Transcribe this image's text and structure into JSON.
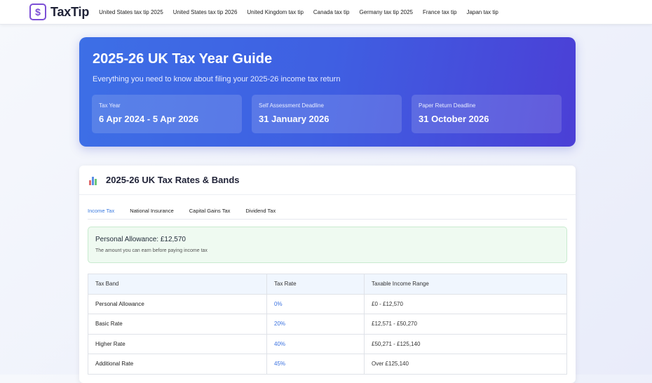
{
  "header": {
    "logo_symbol": "$",
    "logo_text": "TaxTip",
    "nav": [
      "United States tax tip 2025",
      "United States tax tip 2026",
      "United Kingdom tax tip",
      "Canada tax tip",
      "Germany tax tip 2025",
      "France tax tip",
      "Japan tax tip"
    ]
  },
  "hero": {
    "title": "2025-26 UK Tax Year Guide",
    "subtitle": "Everything you need to know about filing your 2025-26 income tax return",
    "cards": [
      {
        "label": "Tax Year",
        "value": "6 Apr 2024 - 5 Apr 2026"
      },
      {
        "label": "Self Assessment Deadline",
        "value": "31 January 2026"
      },
      {
        "label": "Paper Return Deadline",
        "value": "31 October 2026"
      }
    ]
  },
  "rates": {
    "title": "2025-26 UK Tax Rates & Bands",
    "tabs": [
      "Income Tax",
      "National Insurance",
      "Capital Gains Tax",
      "Dividend Tax"
    ],
    "active_tab": "Income Tax",
    "allowance": {
      "title": "Personal Allowance: £12,570",
      "description": "The amount you can earn before paying income tax"
    },
    "table": {
      "headers": [
        "Tax Band",
        "Tax Rate",
        "Taxable Income Range"
      ],
      "rows": [
        [
          "Personal Allowance",
          "0%",
          "£0 - £12,570"
        ],
        [
          "Basic Rate",
          "20%",
          "£12,571 - £50,270"
        ],
        [
          "Higher Rate",
          "40%",
          "£50,271 - £125,140"
        ],
        [
          "Additional Rate",
          "45%",
          "Over £125,140"
        ]
      ]
    }
  },
  "colors": {
    "brand": "#7c4fd6",
    "hero_start": "#3d6fe6",
    "hero_end": "#4b3fd6",
    "accent_link": "#3b72e0",
    "allowance_bg": "#effaf1"
  },
  "icons": {
    "logo": "dollar-icon",
    "rates_section": "bar-chart-icon"
  }
}
